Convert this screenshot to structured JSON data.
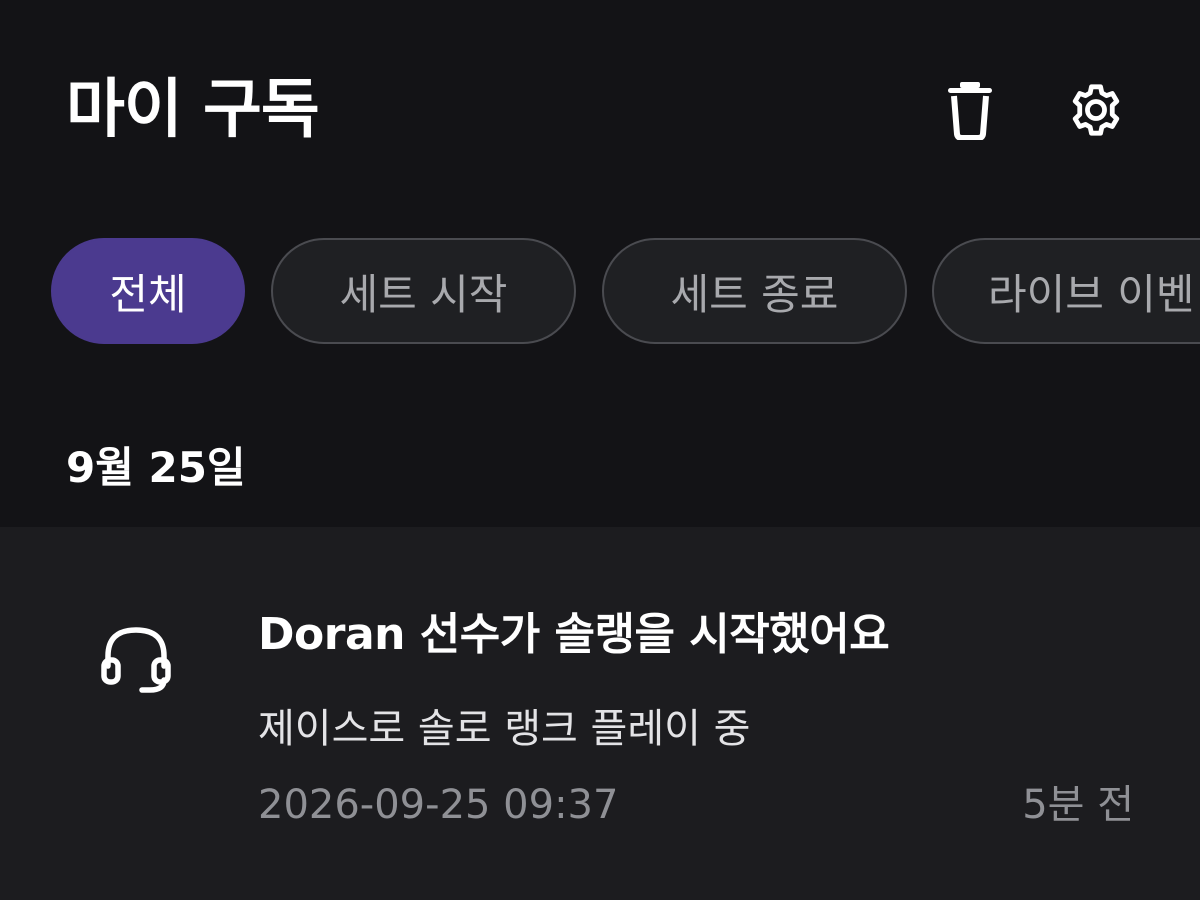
{
  "header": {
    "title": "마이 구독",
    "actions": [
      {
        "icon": "trash-icon"
      },
      {
        "icon": "gear-icon"
      }
    ]
  },
  "filters": {
    "chips": [
      {
        "label": "전체",
        "active": true
      },
      {
        "label": "세트 시작",
        "active": false
      },
      {
        "label": "세트 종료",
        "active": false
      },
      {
        "label": "라이브 이벤",
        "active": false
      }
    ]
  },
  "section": {
    "date": "9월 25일"
  },
  "notification": {
    "icon": "headset-icon",
    "title": "Doran 선수가 솔랭을 시작했어요",
    "subtitle": "제이스로 솔로 랭크 플레이 중",
    "timestamp": "2026-09-25 09:37",
    "relative_time": "5분 전"
  },
  "colors": {
    "background": "#131316",
    "card_background": "#1c1c1f",
    "accent": "#4b3a8f",
    "chip_border": "#4a4b50",
    "muted_text": "#8f9095"
  }
}
